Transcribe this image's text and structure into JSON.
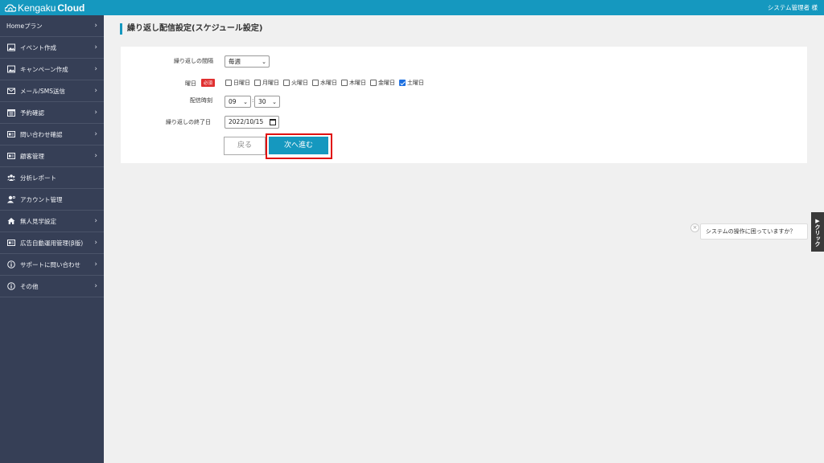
{
  "header": {
    "logo_light": "Kengaku",
    "logo_bold": "Cloud",
    "user": "システム管理者 様"
  },
  "sidebar": {
    "items": [
      {
        "label": "Homeプラン",
        "icon": "none",
        "chevron": "›"
      },
      {
        "label": "イベント作成",
        "icon": "image-icon",
        "chevron": "›"
      },
      {
        "label": "キャンペーン作成",
        "icon": "image-icon",
        "chevron": "›"
      },
      {
        "label": "メール/SMS送信",
        "icon": "mail-icon",
        "chevron": "›"
      },
      {
        "label": "予約確認",
        "icon": "calendar-icon",
        "chevron": "›"
      },
      {
        "label": "問い合わせ確認",
        "icon": "id-card-icon",
        "chevron": "›"
      },
      {
        "label": "顧客管理",
        "icon": "id-card-icon",
        "chevron": "›"
      },
      {
        "label": "分析レポート",
        "icon": "users-icon",
        "chevron": ""
      },
      {
        "label": "アカウント管理",
        "icon": "user-gear-icon",
        "chevron": ""
      },
      {
        "label": "無人見学設定",
        "icon": "home-icon",
        "chevron": "›"
      },
      {
        "label": "広告自動運用管理(β版)",
        "icon": "id-card-icon",
        "chevron": "›"
      },
      {
        "label": "サポートに問い合わせ",
        "icon": "info-icon",
        "chevron": "›"
      },
      {
        "label": "その他",
        "icon": "info-icon",
        "chevron": "›"
      }
    ]
  },
  "page": {
    "title": "繰り返し配信設定(スケジュール設定)"
  },
  "form": {
    "interval_label": "繰り返しの間隔",
    "interval_value": "毎週",
    "weekday_label": "曜日",
    "required_badge": "必須",
    "days": [
      {
        "label": "日曜日",
        "checked": false
      },
      {
        "label": "月曜日",
        "checked": false
      },
      {
        "label": "火曜日",
        "checked": false
      },
      {
        "label": "水曜日",
        "checked": false
      },
      {
        "label": "木曜日",
        "checked": false
      },
      {
        "label": "金曜日",
        "checked": false
      },
      {
        "label": "土曜日",
        "checked": true
      }
    ],
    "time_label": "配信時刻",
    "hour_value": "09",
    "time_separator": ":",
    "minute_value": "30",
    "end_date_label": "繰り返しの終了日",
    "end_date_value": "2022/10/15",
    "back_label": "戻る",
    "next_label": "次へ進む"
  },
  "help": {
    "close": "×",
    "bubble_text": "システムの操作に困っていますか？",
    "tab_text": "▶クリック"
  },
  "colors": {
    "brand": "#1598bf",
    "sidebar": "#363f56",
    "highlight": "#e01010",
    "required": "#e03030"
  }
}
